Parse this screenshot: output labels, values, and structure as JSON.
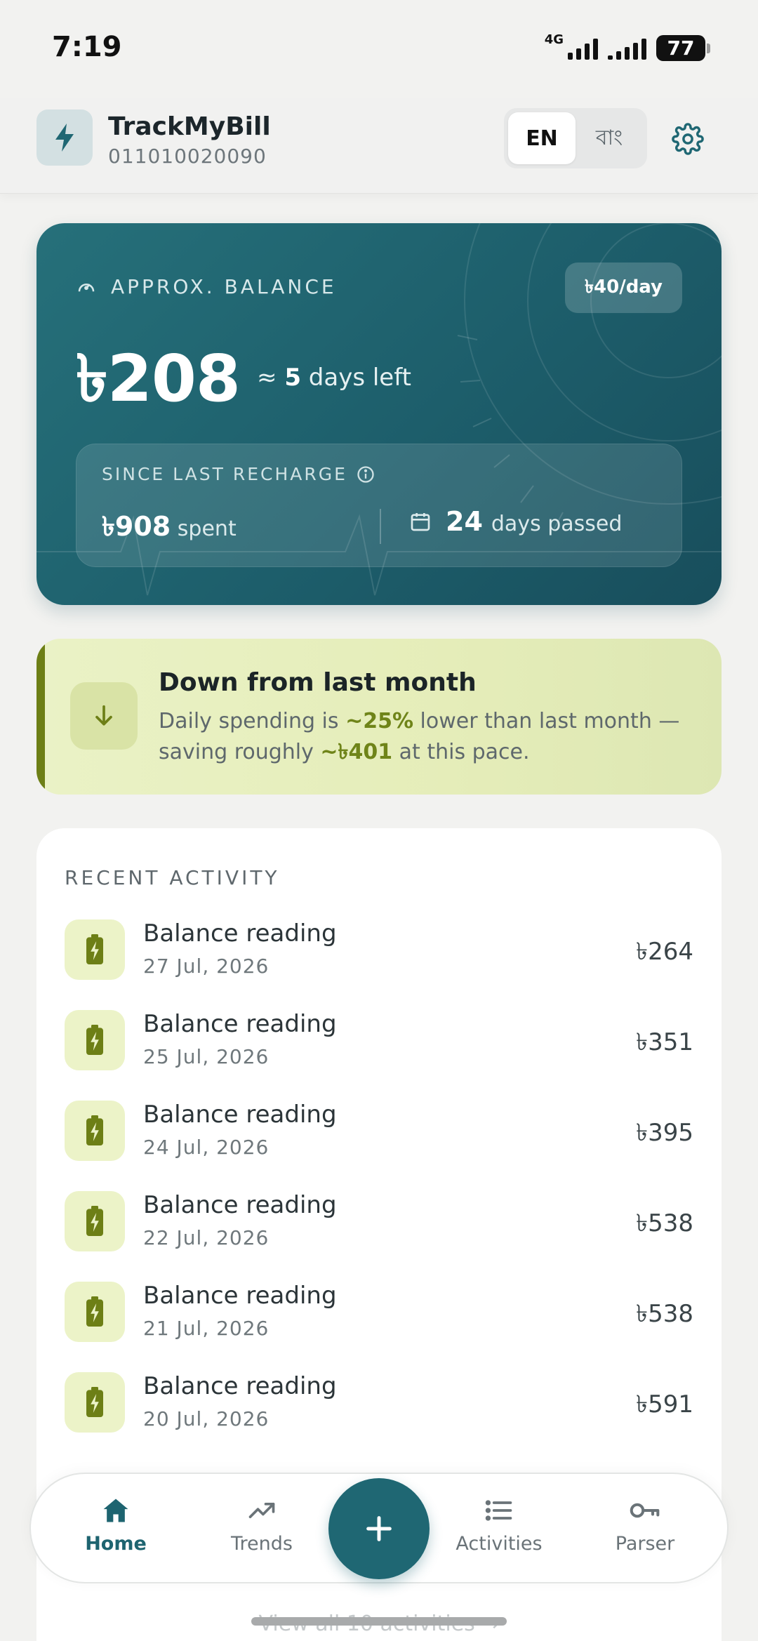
{
  "status_bar": {
    "time": "7:19",
    "network": "4G",
    "battery": "77"
  },
  "header": {
    "app_title": "TrackMyBill",
    "account_number": "011010020090",
    "lang_en": "EN",
    "lang_bn": "বাং",
    "icons": {
      "logo": "lightning-icon",
      "settings": "gear-icon"
    }
  },
  "balance_card": {
    "label": "APPROX. BALANCE",
    "rate": "৳40/day",
    "amount": "৳208",
    "approx_symbol": "≈",
    "days_left_value": "5",
    "days_left_text": "days left",
    "since_label": "SINCE LAST RECHARGE",
    "spent_value": "৳908",
    "spent_text": "spent",
    "days_passed_value": "24",
    "days_passed_text": "days passed",
    "colors": {
      "background": "#1d5e6b"
    }
  },
  "insight": {
    "title": "Down from last month",
    "text_1": "Daily spending is ",
    "percent": "~25%",
    "text_2": " lower than last month — saving roughly ",
    "saving": "~৳401",
    "text_3": " at this pace.",
    "colors": {
      "accent": "#6d7f16"
    }
  },
  "activity": {
    "heading": "RECENT ACTIVITY",
    "items": [
      {
        "title": "Balance reading",
        "date": "27 Jul, 2026",
        "amount": "৳264"
      },
      {
        "title": "Balance reading",
        "date": "25 Jul, 2026",
        "amount": "৳351"
      },
      {
        "title": "Balance reading",
        "date": "24 Jul, 2026",
        "amount": "৳395"
      },
      {
        "title": "Balance reading",
        "date": "22 Jul, 2026",
        "amount": "৳538"
      },
      {
        "title": "Balance reading",
        "date": "21 Jul, 2026",
        "amount": "৳538"
      },
      {
        "title": "Balance reading",
        "date": "20 Jul, 2026",
        "amount": "৳591"
      }
    ],
    "view_all": "View all 10 activities →"
  },
  "nav": {
    "home": "Home",
    "trends": "Trends",
    "activities": "Activities",
    "parser": "Parser",
    "add_icon": "plus-icon",
    "colors": {
      "primary": "#1f6773"
    }
  }
}
